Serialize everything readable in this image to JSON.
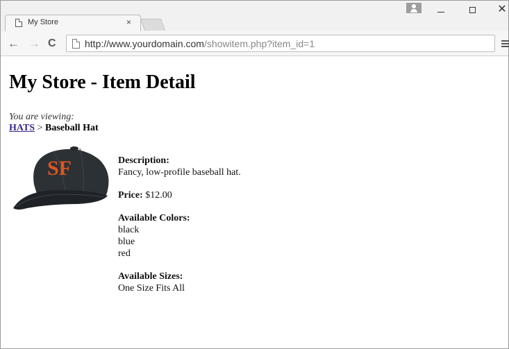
{
  "browser": {
    "tab_title": "My Store",
    "tab_close": "×",
    "url_host": "http://www.yourdomain.com",
    "url_path": "/showitem.php?item_id=1",
    "window_close": "✕",
    "nav_back": "←",
    "nav_forward": "→",
    "nav_reload": "C"
  },
  "page": {
    "title": "My Store - Item Detail",
    "viewing_label": "You are viewing:",
    "breadcrumb": {
      "category": "HATS",
      "separator": " > ",
      "current": "Baseball Hat"
    },
    "description_label": "Description:",
    "description": "Fancy, low-profile baseball hat.",
    "price_label": "Price:",
    "price": "$12.00",
    "colors_label": "Available Colors:",
    "colors": [
      "black",
      "blue",
      "red"
    ],
    "sizes_label": "Available Sizes:",
    "sizes": [
      "One Size Fits All"
    ]
  },
  "icons": {
    "tab_page": "page-icon",
    "user": "user-icon",
    "menu": "hamburger-menu-icon",
    "product_logo": "SF"
  },
  "colors": {
    "link": "#3a2a8c",
    "cap": "#2a2e33",
    "logo": "#e0561c"
  }
}
